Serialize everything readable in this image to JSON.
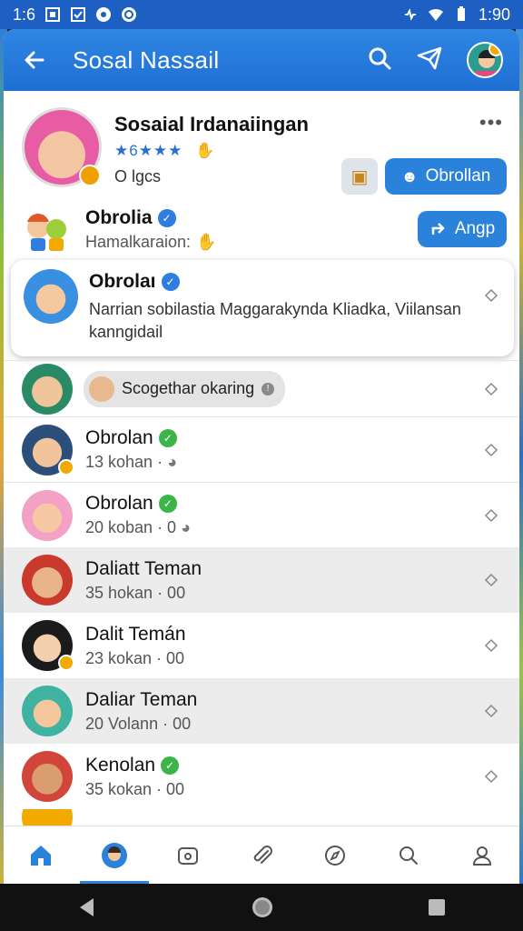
{
  "status_bar": {
    "left_time": "1:6",
    "right_time": "1:90"
  },
  "app_bar": {
    "title": "Sosal Nassail"
  },
  "profile": {
    "name": "Sosaial Irdanaiingan",
    "rating_text": "★6★★★",
    "subtitle": "O lgcs",
    "chat_button_label": "Obrollan"
  },
  "rows": [
    {
      "title": "Obrolia",
      "subtitle": "Hamalkaraion:",
      "button_label": "Angp"
    },
    {
      "title": "Obrolaı",
      "subtitle": "Narrian sobilastia Maggarakynda Kliadka, Viilansan kanngidail"
    },
    {
      "pill_label": "Scogethar okaring"
    },
    {
      "title": "Obrolan",
      "subtitle": "13 kohan ·"
    },
    {
      "title": "Obrolan",
      "subtitle": "20 koban · 0"
    },
    {
      "title": "Daliatt Teman",
      "subtitle": "35 hokan · 00"
    },
    {
      "title": "Dalit Temán",
      "subtitle": "23 kokan · 00"
    },
    {
      "title": "Daliar Teman",
      "subtitle": "20 Volann · 00"
    },
    {
      "title": "Kenolan",
      "subtitle": "35 kokan · 00"
    }
  ],
  "colors": {
    "primary": "#2a82db",
    "status_bar": "#1d5fc2",
    "verified_blue": "#2f7de0",
    "verified_green": "#3bb54a"
  }
}
